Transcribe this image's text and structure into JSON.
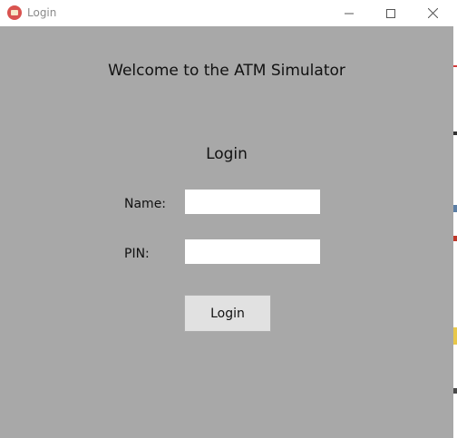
{
  "window": {
    "title": "Login",
    "icon": "app-icon",
    "controls": {
      "minimize_icon": "minimize-icon",
      "maximize_icon": "maximize-icon",
      "close_icon": "close-icon"
    }
  },
  "form": {
    "welcome_text": "Welcome to the ATM Simulator",
    "heading": "Login",
    "name_label": "Name:",
    "name_value": "",
    "pin_label": "PIN:",
    "pin_value": "",
    "submit_label": "Login"
  },
  "colors": {
    "client_background": "#a8a8a8",
    "input_background": "#ffffff",
    "button_background": "#e1e1e1"
  }
}
